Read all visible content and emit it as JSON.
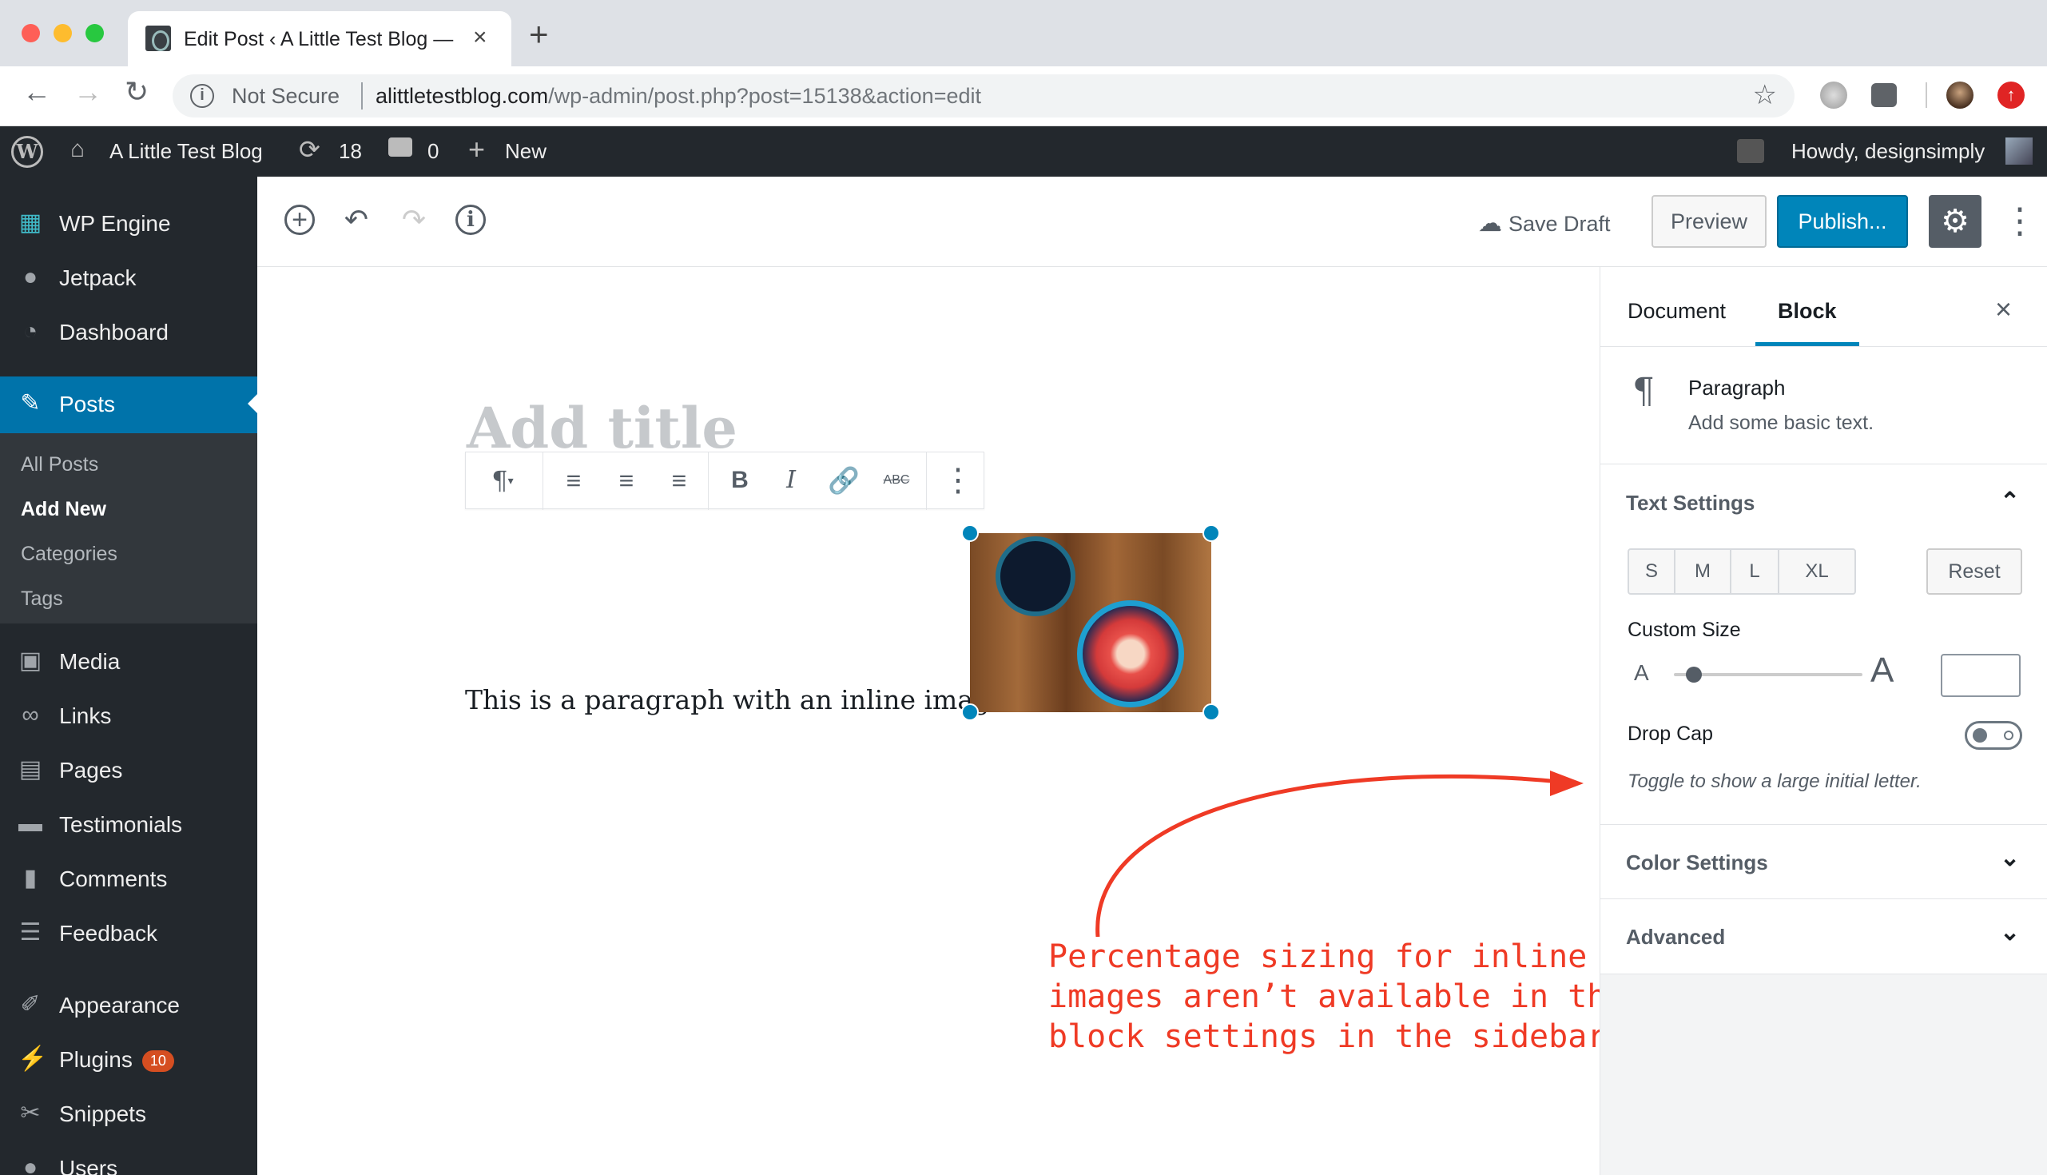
{
  "browser": {
    "tab_title": "Edit Post ‹ A Little Test Blog —",
    "tab_close": "×",
    "new_tab": "+",
    "security_label": "Not Secure",
    "url_host": "alittletestblog.com",
    "url_path": "/wp-admin/post.php?post=15138&action=edit"
  },
  "adminbar": {
    "site_name": "A Little Test Blog",
    "updates_count": "18",
    "comments_count": "0",
    "new_label": "New",
    "greeting": "Howdy, designsimply"
  },
  "sidebar": {
    "items": [
      {
        "label": "WP Engine",
        "icon": "grid-icon"
      },
      {
        "label": "Jetpack",
        "icon": "bolt-icon"
      },
      {
        "label": "Dashboard",
        "icon": "gauge-icon"
      },
      {
        "label": "Posts",
        "icon": "pin-icon"
      },
      {
        "label": "Media",
        "icon": "media-icon"
      },
      {
        "label": "Links",
        "icon": "link-icon"
      },
      {
        "label": "Pages",
        "icon": "pages-icon"
      },
      {
        "label": "Testimonials",
        "icon": "quote-icon"
      },
      {
        "label": "Comments",
        "icon": "comment-icon"
      },
      {
        "label": "Feedback",
        "icon": "feedback-icon"
      },
      {
        "label": "Appearance",
        "icon": "brush-icon"
      },
      {
        "label": "Plugins",
        "icon": "plug-icon",
        "badge": "10"
      },
      {
        "label": "Snippets",
        "icon": "scissors-icon"
      },
      {
        "label": "Users",
        "icon": "user-icon"
      }
    ],
    "submenu": [
      "All Posts",
      "Add New",
      "Categories",
      "Tags"
    ]
  },
  "editor": {
    "save_draft": "Save Draft",
    "preview": "Preview",
    "publish": "Publish...",
    "title_placeholder": "Add title",
    "paragraph_text": "This is a paragraph with an inline image.",
    "block_toolbar": {
      "strikethrough_label": "ABC"
    }
  },
  "annotation": {
    "text": "Percentage sizing for inline\nimages aren’t available in the\nblock settings in the sidebar.",
    "color": "#ef3a25"
  },
  "settings": {
    "tabs": [
      "Document",
      "Block"
    ],
    "active_tab": "Block",
    "close": "×",
    "block_name": "Paragraph",
    "block_desc": "Add some basic text.",
    "text_settings": "Text Settings",
    "sizes": [
      "S",
      "M",
      "L",
      "XL"
    ],
    "reset": "Reset",
    "custom_size": "Custom Size",
    "small_a": "A",
    "big_a": "A",
    "drop_cap": "Drop Cap",
    "drop_cap_help": "Toggle to show a large initial letter.",
    "color_settings": "Color Settings",
    "advanced": "Advanced"
  },
  "colors": {
    "accent": "#0085ba",
    "admin_bg": "#23282d",
    "menu_active": "#0073aa"
  }
}
